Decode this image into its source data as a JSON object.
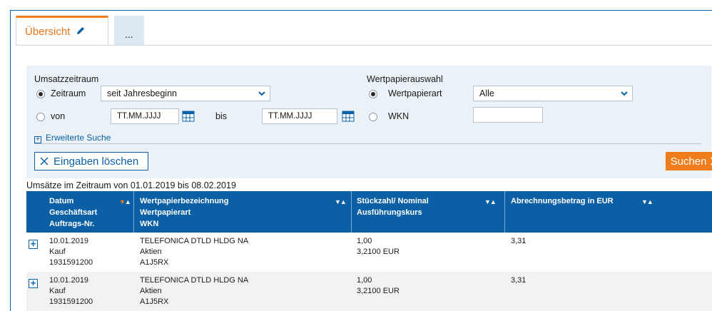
{
  "tabs": {
    "overview_label": "Übersicht",
    "more_label": "..."
  },
  "filters": {
    "period_group_label": "Umsatzzeitraum",
    "period_radio_label": "Zeitraum",
    "period_value": "seit Jahresbeginn",
    "from_label": "von",
    "from_placeholder": "TT.MM.JJJJ",
    "to_label": "bis",
    "to_placeholder": "TT.MM.JJJJ",
    "security_group_label": "Wertpapierauswahl",
    "security_type_label": "Wertpapierart",
    "security_type_value": "Alle",
    "wkn_label": "WKN",
    "wkn_value": "",
    "advanced_search_label": "Erweiterte Suche",
    "clear_label": "Eingaben löschen",
    "search_label": "Suchen"
  },
  "caption": "Umsätze im Zeitraum von 01.01.2019 bis 08.02.2019",
  "table": {
    "col1": [
      "Datum",
      "Geschäftsart",
      "Auftrags-Nr."
    ],
    "col2": [
      "Wertpapierbezeichnung",
      "Wertpapierart",
      "WKN"
    ],
    "col3": [
      "Stückzahl/ Nominal",
      "Ausführungskurs"
    ],
    "col4": [
      "Abrechnungsbetrag in EUR"
    ],
    "rows": [
      {
        "date": "10.01.2019",
        "type": "Kauf",
        "order": "1931591200",
        "name": "TELEFONICA DTLD HLDG NA",
        "sec_type": "Aktien",
        "wkn": "A1J5RX",
        "qty": "1,00",
        "price": "3,2100 EUR",
        "amount": "3,31"
      },
      {
        "date": "10.01.2019",
        "type": "Kauf",
        "order": "1931591200",
        "name": "TELEFONICA DTLD HLDG NA",
        "sec_type": "Aktien",
        "wkn": "A1J5RX",
        "qty": "1,00",
        "price": "3,2100 EUR",
        "amount": "3,31"
      }
    ]
  },
  "colors": {
    "accent": "#f07c1b",
    "primary": "#0b5fa5",
    "panel": "#eaf1f7"
  }
}
